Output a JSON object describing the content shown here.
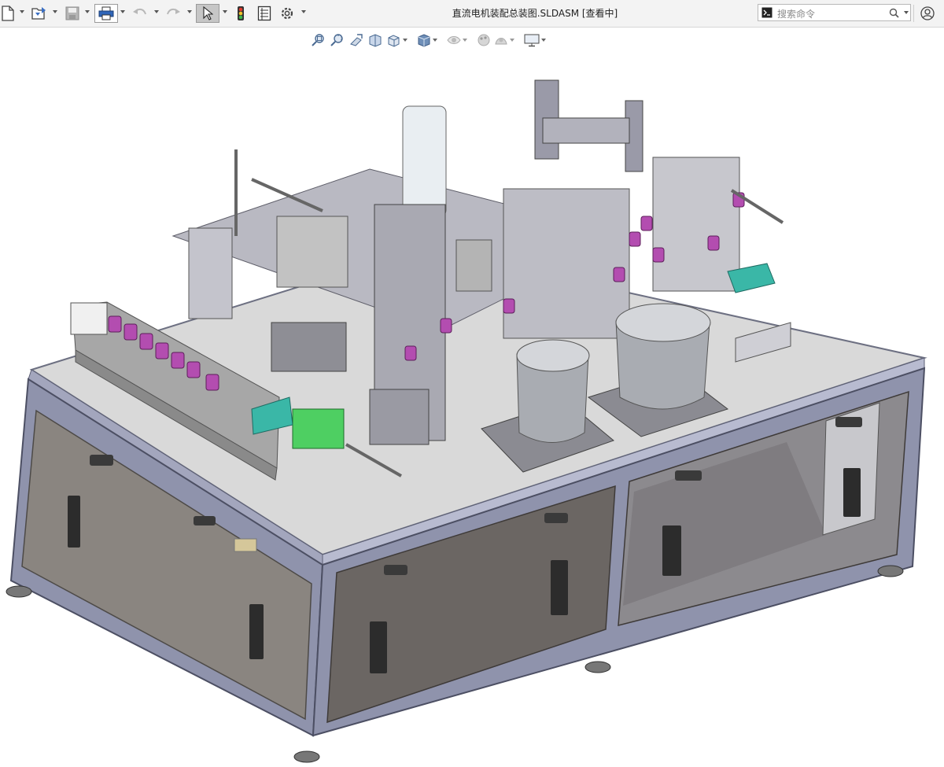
{
  "window": {
    "title": "直流电机装配总装图.SLDASM [查看中]"
  },
  "toolbar": {
    "items": [
      "new-document",
      "open-file",
      "save",
      "print",
      "undo",
      "redo",
      "select",
      "rebuild",
      "file-properties",
      "options"
    ]
  },
  "search": {
    "placeholder": "搜索命令"
  },
  "heads_up": {
    "items": [
      "zoom-to-fit",
      "zoom-to-area",
      "previous-view",
      "section-view",
      "view-orientation",
      "display-style",
      "hide-show-items",
      "edit-appearance",
      "apply-scene",
      "view-settings"
    ]
  },
  "model": {
    "colors": {
      "frame": "#8f93ac",
      "panel": "#8a8580",
      "panel_dark": "#6b6663",
      "table_top": "#d8d8d8",
      "accent_magenta": "#b34db0",
      "accent_green": "#4ecf62",
      "accent_teal": "#3ab7a7"
    }
  }
}
